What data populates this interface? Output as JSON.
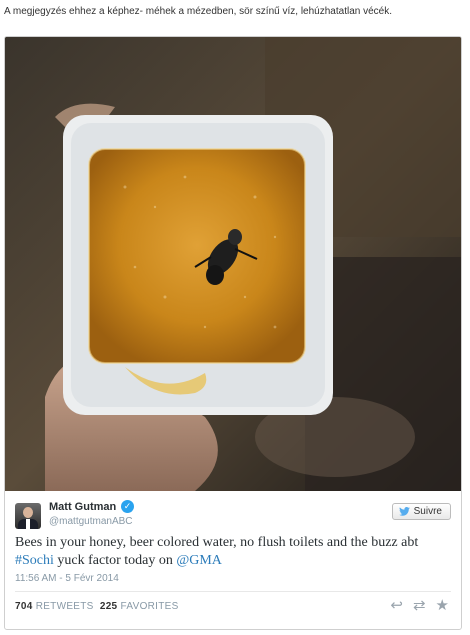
{
  "caption": "A megjegyzés ehhez a képhez- méhek a mézedben, sör színű víz, lehúzhatatlan vécék.",
  "tweet": {
    "author_name": "Matt Gutman",
    "handle": "@mattgutmanABC",
    "follow_label": "Suivre",
    "text_before": "Bees in your honey, beer colored water, no flush toilets and the buzz abt ",
    "hashtag": "#Sochi",
    "text_middle": " yuck factor today on ",
    "mention": "@GMA",
    "timestamp": "11:56 AM - 5 Févr 2014",
    "retweets_count": "704",
    "retweets_label": "RETWEETS",
    "favorites_count": "225",
    "favorites_label": "FAVORITES"
  },
  "icons": {
    "verified": "verified-badge-icon",
    "follow": "twitter-bird-icon",
    "reply": "reply-icon",
    "retweet": "retweet-icon",
    "favorite": "star-icon"
  },
  "colors": {
    "link": "#2b7bb9",
    "verified": "#2aa3ef",
    "honey": "#c98a18"
  }
}
